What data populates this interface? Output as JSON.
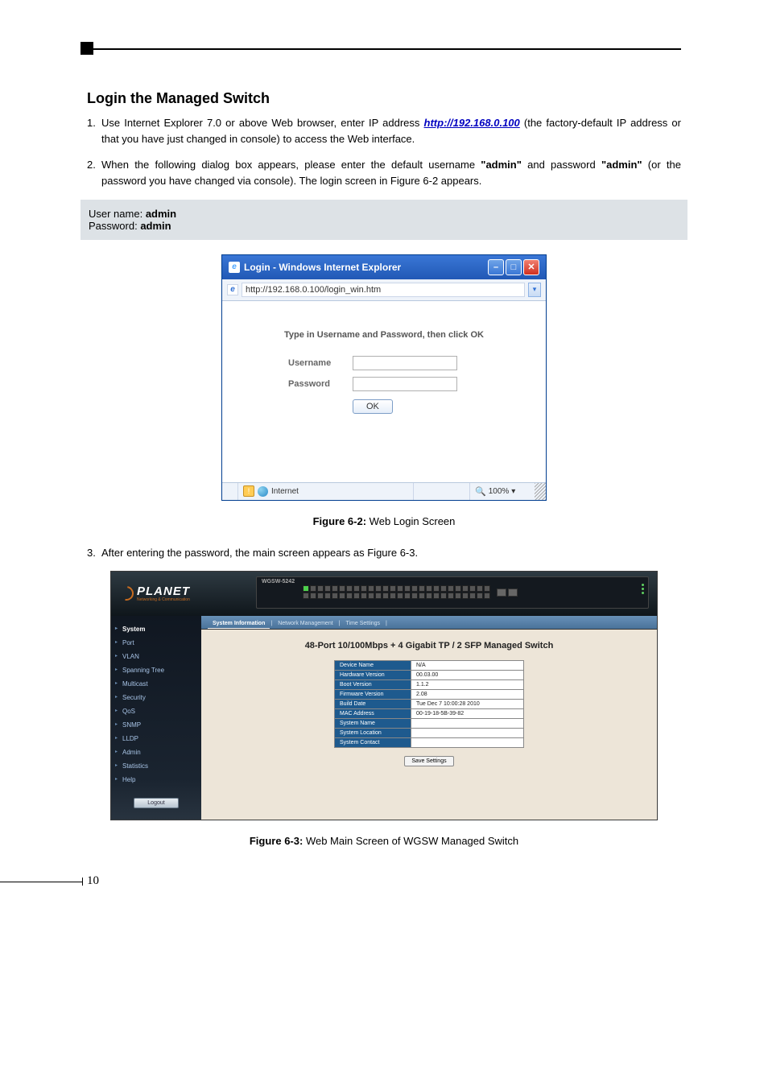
{
  "section_title": "Login the Managed Switch",
  "steps": {
    "1_before_link": "Use Internet Explorer 7.0 or above Web browser, enter IP address ",
    "1_link": "http://192.168.0.100",
    "1_after_link": " (the factory-default IP address or that you have just changed in console) to access the Web interface.",
    "2_a": "When the following dialog box appears, please enter the default username ",
    "2_b": "\"admin\"",
    "2_c": " and password ",
    "2_d": "\"admin\"",
    "2_e": " (or the password you have changed via console). The login screen in Figure 6-2 appears.",
    "3": "After entering the password, the main screen appears as Figure 6-3."
  },
  "creds": {
    "user_label": "User name: ",
    "user_value": "admin",
    "pass_label": "Password: ",
    "pass_value": "admin"
  },
  "ie": {
    "title": "Login - Windows Internet Explorer",
    "url": "http://192.168.0.100/login_win.htm",
    "instruction": "Type in Username and Password, then click OK",
    "username_label": "Username",
    "password_label": "Password",
    "ok": "OK",
    "zone": "Internet",
    "zoom": "100%",
    "minimize": "–",
    "maximize": "□",
    "close": "✕",
    "dropdown": "▾",
    "zoom_dropdown": "▾"
  },
  "fig62_label": "Figure 6-2:",
  "fig62_text": "  Web Login Screen",
  "fig63_label": "Figure 6-3:",
  "fig63_text": "  Web Main Screen of WGSW Managed Switch",
  "switch": {
    "brand": "PLANET",
    "brand_sub": "Networking & Communication",
    "model": "WGSW-5242",
    "nav": [
      "System",
      "Port",
      "VLAN",
      "Spanning Tree",
      "Multicast",
      "Security",
      "QoS",
      "SNMP",
      "LLDP",
      "Admin",
      "Statistics",
      "Help"
    ],
    "logout": "Logout",
    "tabs": [
      "System Information",
      "Network Management",
      "Time Settings"
    ],
    "main_title": "48-Port 10/100Mbps + 4 Gigabit TP / 2 SFP Managed Switch",
    "info": [
      {
        "k": "Device Name",
        "v": "N/A"
      },
      {
        "k": "Hardware Version",
        "v": "00.03.00"
      },
      {
        "k": "Boot Version",
        "v": "1.1.2"
      },
      {
        "k": "Firmware Version",
        "v": "2.08"
      },
      {
        "k": "Build Date",
        "v": "Tue Dec 7 10:00:28 2010"
      },
      {
        "k": "MAC Address",
        "v": "00-19-18-5B-39-82"
      },
      {
        "k": "System Name",
        "v": ""
      },
      {
        "k": "System Location",
        "v": ""
      },
      {
        "k": "System Contact",
        "v": ""
      }
    ],
    "save": "Save Settings"
  },
  "page_number": "10"
}
